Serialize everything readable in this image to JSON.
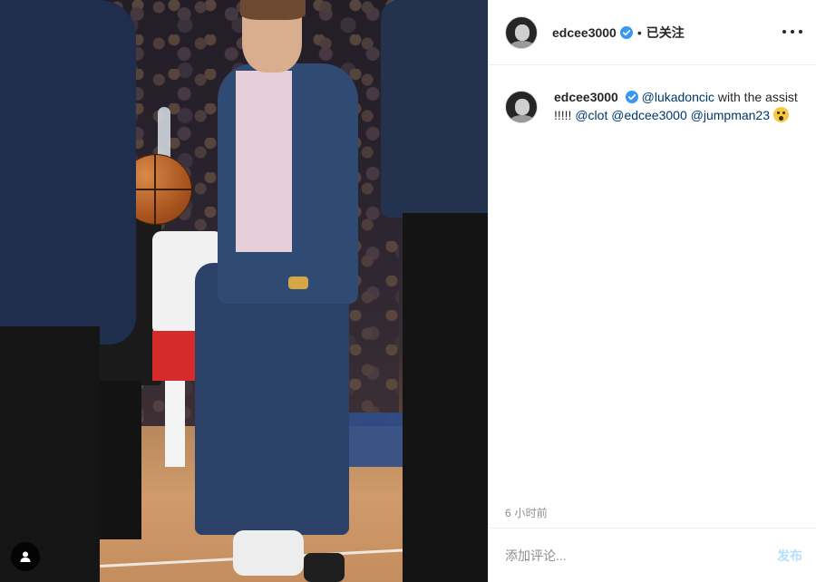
{
  "post": {
    "username": "edcee3000",
    "separator": "•",
    "follow_status": "已关注",
    "caption": {
      "username": "edcee3000",
      "mention_luka": "@lukadoncic",
      "text_1": " with the assist !!!!! ",
      "mention_clot": "@clot",
      "mention_edcee": "@edcee3000",
      "mention_jumpman": "@jumpman23"
    },
    "time": "6 小时前"
  },
  "comment": {
    "placeholder": "添加评论...",
    "post_label": "发布"
  },
  "colors": {
    "verified": "#3897f0",
    "mention": "#00376b",
    "post_button_disabled": "#b2dffc"
  },
  "icons": [
    "verified-badge-icon",
    "more-options-icon",
    "user-tag-icon",
    "shocked-face-emoji"
  ]
}
